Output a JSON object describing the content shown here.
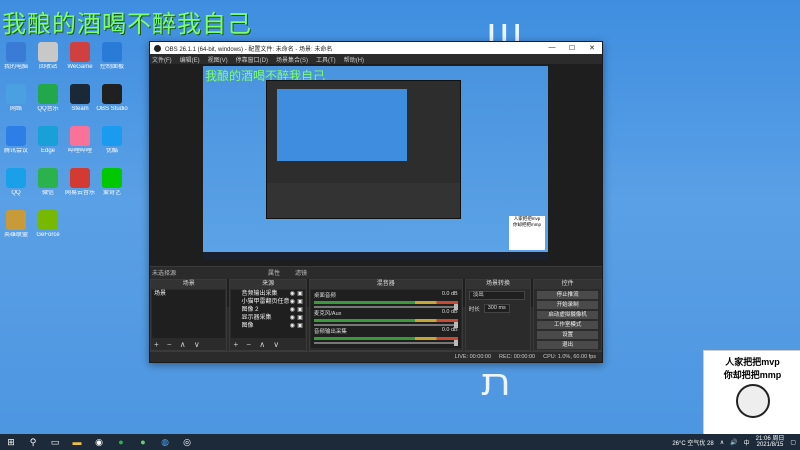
{
  "overlay_title": "我酿的酒喝不醉我自己",
  "desktop_icons": [
    {
      "label": "我的电脑",
      "color": "#3a7bd5"
    },
    {
      "label": "回收站",
      "color": "#c8c8c8"
    },
    {
      "label": "WeGame",
      "color": "#d04040"
    },
    {
      "label": "控制面板",
      "color": "#2a7ad8"
    },
    {
      "label": "网络",
      "color": "#4aa0e0"
    },
    {
      "label": "QQ音乐",
      "color": "#22a84a"
    },
    {
      "label": "Steam",
      "color": "#1b2838"
    },
    {
      "label": "OBS Studio",
      "color": "#202020"
    },
    {
      "label": "腾讯会议",
      "color": "#2d7ee6"
    },
    {
      "label": "Edge",
      "color": "#1aa0d8"
    },
    {
      "label": "哔哩哔哩",
      "color": "#fb7299"
    },
    {
      "label": "优酷",
      "color": "#1a9bf0"
    },
    {
      "label": "QQ",
      "color": "#1aa0e8"
    },
    {
      "label": "微信",
      "color": "#2bb24c"
    },
    {
      "label": "网易云音乐",
      "color": "#d33a31"
    },
    {
      "label": "爱奇艺",
      "color": "#00c800"
    },
    {
      "label": "英雄联盟",
      "color": "#c89a3a"
    },
    {
      "label": "GeForce",
      "color": "#76b900"
    }
  ],
  "obs": {
    "window_title": "OBS 26.1.1 (64-bit, windows) - 配置文件: 未命名 - 场景: 未命名",
    "menu": [
      "文件(F)",
      "编辑(E)",
      "视图(V)",
      "停靠窗口(D)",
      "场景集合(S)",
      "工具(T)",
      "帮助(H)"
    ],
    "ctrl_min": "—",
    "ctrl_max": "☐",
    "ctrl_close": "✕",
    "no_source": "未选择源",
    "tab_props": "属性",
    "tab_filters": "滤镜",
    "docks": {
      "scenes": {
        "title": "场景",
        "items": [
          "场景"
        ]
      },
      "sources": {
        "title": "来源",
        "items": [
          "音频输出采集",
          "小猫甲雷翻页任意",
          "图像 2",
          "显示器采集",
          "图像"
        ]
      },
      "mixer": {
        "title": "混音器",
        "channels": [
          {
            "name": "桌面音频",
            "db": "0.0 dB"
          },
          {
            "name": "麦克风/Aux",
            "db": "0.0 dB"
          },
          {
            "name": "音频输出采集",
            "db": "0.0 dB"
          }
        ]
      },
      "transitions": {
        "title": "场景转换",
        "type": "淡出",
        "duration_label": "时长",
        "duration": "300 ms"
      },
      "controls": {
        "title": "控件",
        "buttons": [
          "停止推流",
          "开始录制",
          "启动虚拟摄像机",
          "工作室模式",
          "设置",
          "退出"
        ]
      }
    },
    "footer_btns": "+ − ∧ ∨",
    "status": {
      "live": "LIVE: 00:00:00",
      "rec": "REC: 00:00:00",
      "cpu": "CPU: 1.0%, 60.00 fps"
    }
  },
  "meme": {
    "line1": "人家把把mvp",
    "line2": "你却把把mmp"
  },
  "canvas_meme": {
    "line1": "人家把把mvp",
    "line2": "你却把把mmp"
  },
  "taskbar": {
    "weather": "26°C 空气优 28",
    "ime": "中",
    "time": "21:06 周日",
    "date": "2021/8/15"
  }
}
